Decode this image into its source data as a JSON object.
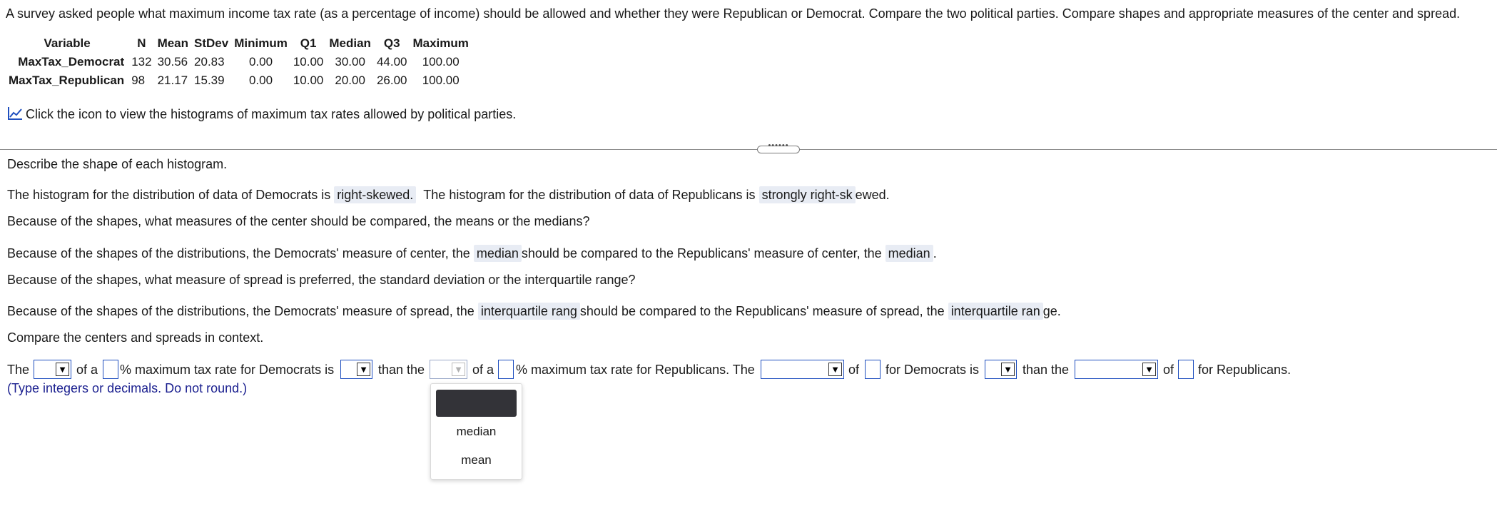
{
  "question": "A survey asked people what maximum income tax rate (as a percentage of income) should be allowed and whether they were Republican or Democrat. Compare the two political parties. Compare shapes and appropriate measures of the center and spread.",
  "stats_table": {
    "headers": [
      "Variable",
      "N",
      "Mean",
      "StDev",
      "Minimum",
      "Q1",
      "Median",
      "Q3",
      "Maximum"
    ],
    "rows": [
      {
        "variable": "MaxTax_Democrat",
        "n": "132",
        "mean": "30.56",
        "stdev": "20.83",
        "min": "0.00",
        "q1": "10.00",
        "median": "30.00",
        "q3": "44.00",
        "max": "100.00"
      },
      {
        "variable": "MaxTax_Republican",
        "n": "98",
        "mean": "21.17",
        "stdev": "15.39",
        "min": "0.00",
        "q1": "10.00",
        "median": "20.00",
        "q3": "26.00",
        "max": "100.00"
      }
    ]
  },
  "histogram_link": {
    "text": "Click the icon to view the histograms of maximum tax rates allowed by political parties.",
    "icon": "chart-line-icon"
  },
  "part1": {
    "prompt": "Describe the shape of each histogram.",
    "sentence_a": "The histogram for the distribution of data of Democrats is",
    "answer_a": "right-skewed.",
    "sentence_b": "The histogram for the distribution of data of Republicans is",
    "answer_b_part": "strongly right-sk",
    "answer_b_rest": "ewed."
  },
  "part2": {
    "prompt": "Because of the shapes, what measures of the center should be compared, the means or the medians?",
    "sentence_a": "Because of the shapes of the distributions, the Democrats' measure of center, the",
    "answer_a": "median",
    "sentence_b": "should be compared to the Republicans' measure of center, the",
    "answer_b": "median",
    "end": "."
  },
  "part3": {
    "prompt": "Because of the shapes, what measure of spread is preferred, the standard deviation or the interquartile range?",
    "sentence_a": "Because of the shapes of the distributions, the Democrats' measure of spread, the",
    "answer_a": "interquartile rang",
    "sentence_b": "should be compared to the Republicans' measure of spread, the",
    "answer_b_part": "interquartile ran",
    "answer_b_rest": "ge."
  },
  "part4": {
    "prompt": "Compare the centers and spreads in context.",
    "t1": "The",
    "t2": "of a",
    "t3": "% maximum tax rate for Democrats is",
    "t4": "than the",
    "t5": "of a",
    "t6": "% maximum tax rate for Republicans. The",
    "t7": "of",
    "t8": "for Democrats is",
    "t9": "than the",
    "t10": "of",
    "t11": "for Republicans.",
    "hint": "(Type integers or decimals. Do not round.)"
  },
  "dropdown": {
    "options": [
      "",
      "median",
      "mean"
    ]
  },
  "colors": {
    "accent": "#1f4fbf",
    "highlight": "#e8ecf4",
    "hint": "#1a1f8f"
  }
}
